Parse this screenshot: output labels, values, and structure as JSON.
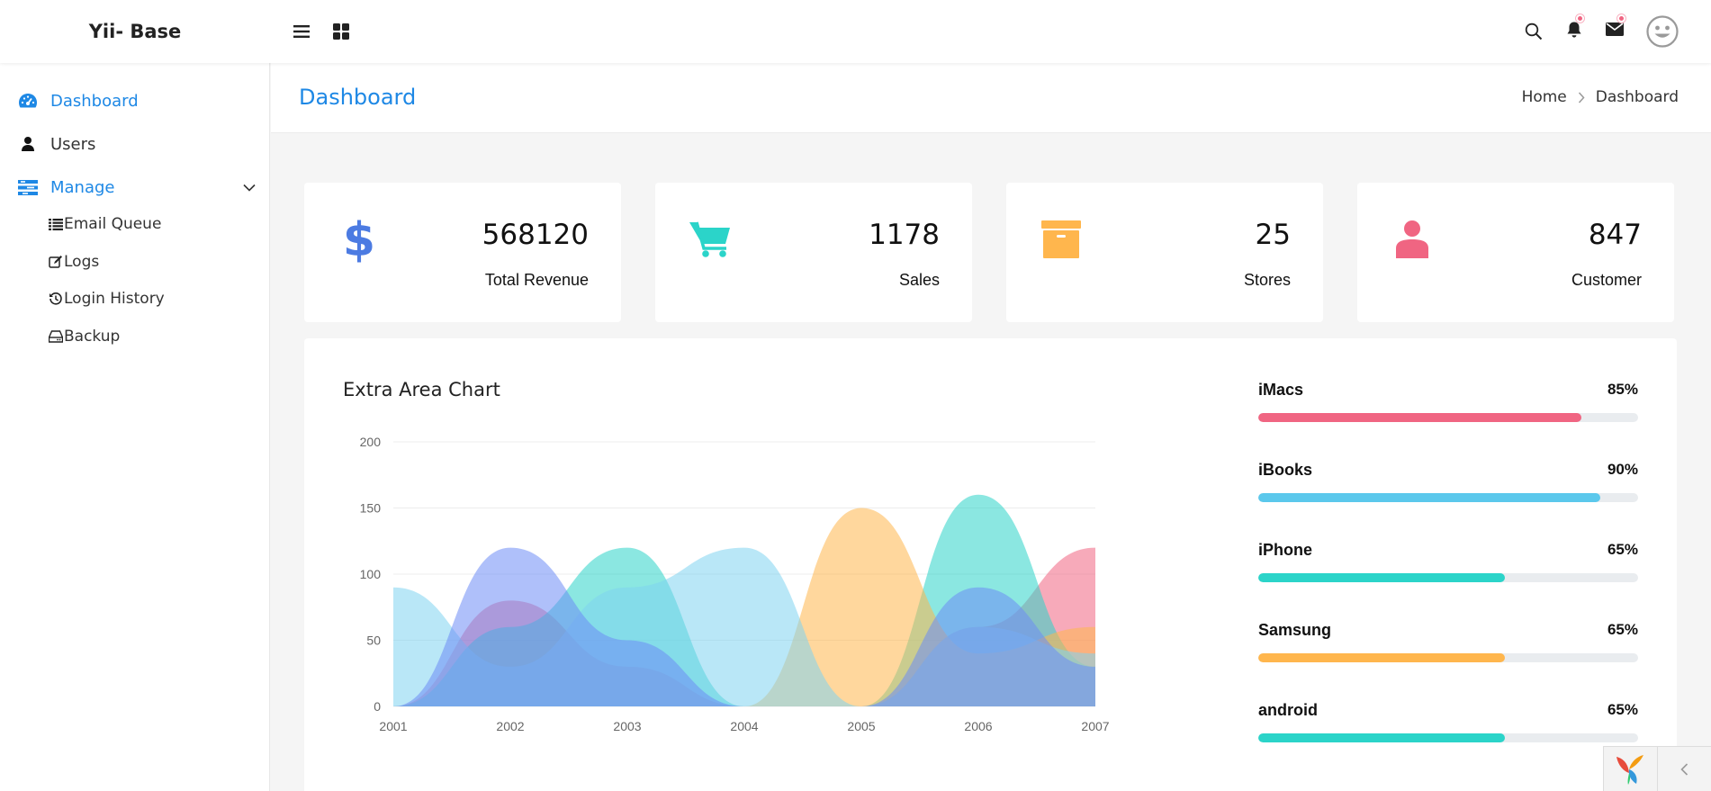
{
  "app": {
    "brand": "Yii- Base"
  },
  "topbar": {
    "icons": [
      "menu-icon",
      "grid-icon",
      "search-icon",
      "bell-icon",
      "mail-icon",
      "user-avatar-icon"
    ],
    "accent": "#f06582"
  },
  "sidebar": {
    "items": [
      {
        "label": "Dashboard",
        "icon": "dashboard-gauge-icon",
        "active": true
      },
      {
        "label": "Users",
        "icon": "user-icon",
        "active": false
      },
      {
        "label": "Manage",
        "icon": "manage-list-icon",
        "active": true
      }
    ],
    "submenu": [
      {
        "label": "Email Queue",
        "icon": "list-icon"
      },
      {
        "label": "Logs",
        "icon": "edit-icon"
      },
      {
        "label": "Login History",
        "icon": "history-icon"
      },
      {
        "label": "Backup",
        "icon": "hdd-icon"
      }
    ]
  },
  "header": {
    "title": "Dashboard",
    "breadcrumb": {
      "home": "Home",
      "current": "Dashboard"
    }
  },
  "stats": [
    {
      "value": "568120",
      "label": "Total Revenue",
      "icon": "dollar-icon",
      "color": "#4c7be2"
    },
    {
      "value": "1178",
      "label": "Sales",
      "icon": "cart-icon",
      "color": "#2bd4c9"
    },
    {
      "value": "25",
      "label": "Stores",
      "icon": "archive-box-icon",
      "color": "#ffb64d"
    },
    {
      "value": "847",
      "label": "Customer",
      "icon": "customer-icon",
      "color": "#f06582"
    }
  ],
  "chart_data": {
    "type": "area",
    "title": "Extra Area Chart",
    "x": [
      "2001",
      "2002",
      "2003",
      "2004",
      "2005",
      "2006",
      "2007"
    ],
    "ylim": [
      0,
      200
    ],
    "yticks": [
      "0",
      "50",
      "100",
      "150",
      "200"
    ],
    "grid": true,
    "series": [
      {
        "color": "#f06582",
        "values": [
          0,
          80,
          30,
          0,
          0,
          60,
          120
        ]
      },
      {
        "color": "#2bd4c9",
        "values": [
          0,
          60,
          120,
          0,
          0,
          160,
          30
        ]
      },
      {
        "color": "#ffb64d",
        "values": [
          0,
          0,
          0,
          0,
          150,
          40,
          60
        ]
      },
      {
        "color": "#7fd3f0",
        "values": [
          90,
          30,
          90,
          120,
          0,
          60,
          40
        ]
      },
      {
        "color": "#6d8df5",
        "values": [
          0,
          120,
          50,
          0,
          0,
          90,
          30
        ]
      }
    ]
  },
  "progress": [
    {
      "name": "iMacs",
      "percent_label": "85%",
      "value": 0.85,
      "color": "#f06582"
    },
    {
      "name": "iBooks",
      "percent_label": "90%",
      "value": 0.9,
      "color": "#5bc8ec"
    },
    {
      "name": "iPhone",
      "percent_label": "65%",
      "value": 0.65,
      "color": "#2bd4c9"
    },
    {
      "name": "Samsung",
      "percent_label": "65%",
      "value": 0.65,
      "color": "#ffb64d"
    },
    {
      "name": "android",
      "percent_label": "65%",
      "value": 0.65,
      "color": "#2bd4c9"
    }
  ],
  "corner_widget": {
    "logo": "yii-logo-icon",
    "toggle": "chevron-left-icon"
  }
}
